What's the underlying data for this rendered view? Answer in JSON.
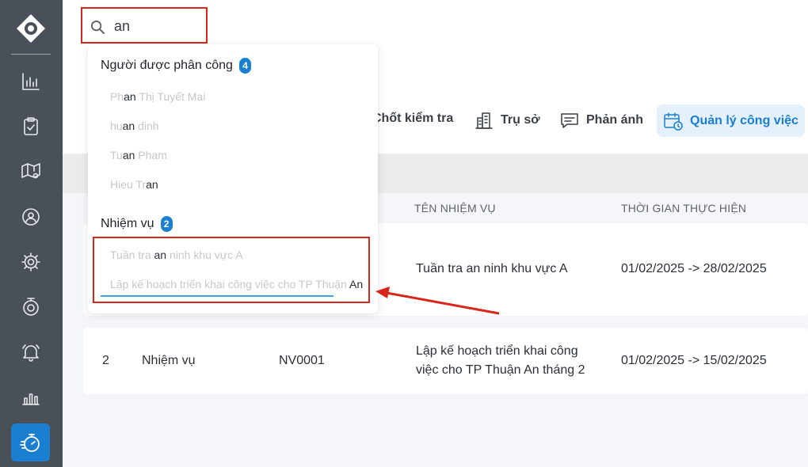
{
  "search": {
    "value": "an",
    "placeholder": ""
  },
  "dropdown": {
    "assignees": {
      "title": "Người được phân công",
      "count": "4",
      "items": [
        {
          "pre": "Ph",
          "match": "an",
          "post": " Thị Tuyết Mai"
        },
        {
          "pre": "hu",
          "match": "an",
          "post": " dinh"
        },
        {
          "pre": "Tu",
          "match": "an",
          "post": " Pham"
        },
        {
          "pre": "Hieu Tr",
          "match": "an",
          "post": ""
        }
      ]
    },
    "tasks": {
      "title": "Nhiệm vụ",
      "count": "2",
      "items": [
        {
          "pre": "Tuần tra ",
          "match": "an",
          "post": " ninh khu vực A"
        },
        {
          "pre": "Lập kế hoạch triển khai công việc cho TP Thuận ",
          "match": "An",
          "post": ""
        }
      ]
    }
  },
  "tabs": [
    {
      "label": "Chốt kiểm tra",
      "icon": "checkpoint-icon"
    },
    {
      "label": "Trụ sở",
      "icon": "building-icon"
    },
    {
      "label": "Phản ánh",
      "icon": "message-icon"
    },
    {
      "label": "Quản lý công việc",
      "icon": "calendar-clock-icon",
      "active": true
    }
  ],
  "table": {
    "headers": [
      "TÊN NHIỆM VỤ",
      "THỜI GIAN THỰC HIỆN"
    ],
    "rows": [
      {
        "name": "Tuần tra an ninh khu vực A",
        "time": "01/02/2025 -> 28/02/2025"
      },
      {
        "index": "2",
        "type": "Nhiệm vụ",
        "code": "NV0001",
        "name_line1": "Lập kế hoạch triển khai công",
        "name_line2": "việc cho TP Thuận An tháng 2",
        "time": "01/02/2025 -> 15/02/2025"
      }
    ]
  },
  "colors": {
    "accent": "#1a7fd0",
    "sidebar": "#495057",
    "annotation": "#d9261c"
  }
}
